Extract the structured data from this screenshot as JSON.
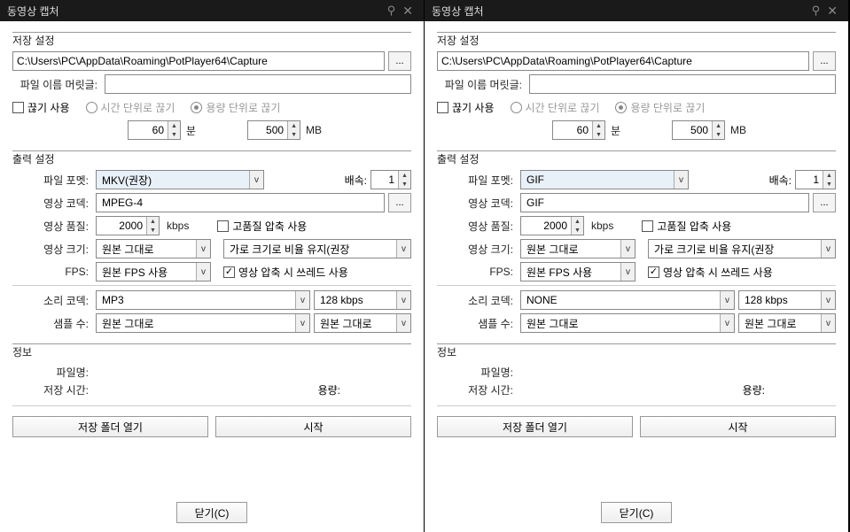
{
  "panels": [
    {
      "title": "동영상 캡처",
      "save": {
        "group": "저장 설정",
        "path": "C:\\Users\\PC\\AppData\\Roaming\\PotPlayer64\\Capture",
        "prefix_label": "파일 이름 머릿글:",
        "prefix_value": "",
        "cut_use": "끊기 사용",
        "cut_time_label": "시간 단위로 끊기",
        "cut_size_label": "용량 단위로 끊기",
        "cut_time_val": "60",
        "cut_time_unit": "분",
        "cut_size_val": "500",
        "cut_size_unit": "MB"
      },
      "output": {
        "group": "출력 설정",
        "format_label": "파일 포멧:",
        "format_value": "MKV(권장)",
        "speed_label": "배속:",
        "speed_value": "1",
        "vcodec_label": "영상 코덱:",
        "vcodec_value": "MPEG-4",
        "vqual_label": "영상 품질:",
        "vqual_value": "2000",
        "vqual_unit": "kbps",
        "hq_label": "고품질 압축 사용",
        "hq_checked": false,
        "vsize_label": "영상 크기:",
        "vsize_value": "원본 그대로",
        "aspect_value": "가로 크기로 비율 유지(권장",
        "fps_label": "FPS:",
        "fps_value": "원본 FPS 사용",
        "thread_label": "영상 압축 시 쓰레드 사용",
        "thread_checked": true,
        "acodec_label": "소리 코덱:",
        "acodec_value": "MP3",
        "abitrate_value": "128 kbps",
        "asample_label": "샘플 수:",
        "asample_value": "원본 그대로",
        "asample2_value": "원본 그대로"
      },
      "info": {
        "group": "정보",
        "filename_label": "파일명:",
        "time_label": "저장 시간:",
        "size_label": "용량:"
      },
      "buttons": {
        "open_folder": "저장 폴더 열기",
        "start": "시작",
        "close": "닫기(C)"
      }
    },
    {
      "title": "동영상 캡처",
      "save": {
        "group": "저장 설정",
        "path": "C:\\Users\\PC\\AppData\\Roaming\\PotPlayer64\\Capture",
        "prefix_label": "파일 이름 머릿글:",
        "prefix_value": "",
        "cut_use": "끊기 사용",
        "cut_time_label": "시간 단위로 끊기",
        "cut_size_label": "용량 단위로 끊기",
        "cut_time_val": "60",
        "cut_time_unit": "분",
        "cut_size_val": "500",
        "cut_size_unit": "MB"
      },
      "output": {
        "group": "출력 설정",
        "format_label": "파일 포멧:",
        "format_value": "GIF",
        "speed_label": "배속:",
        "speed_value": "1",
        "vcodec_label": "영상 코덱:",
        "vcodec_value": "GIF",
        "vqual_label": "영상 품질:",
        "vqual_value": "2000",
        "vqual_unit": "kbps",
        "hq_label": "고품질 압축 사용",
        "hq_checked": false,
        "vsize_label": "영상 크기:",
        "vsize_value": "원본 그대로",
        "aspect_value": "가로 크기로 비율 유지(권장",
        "fps_label": "FPS:",
        "fps_value": "원본 FPS 사용",
        "thread_label": "영상 압축 시 쓰레드 사용",
        "thread_checked": true,
        "acodec_label": "소리 코덱:",
        "acodec_value": "NONE",
        "abitrate_value": "128 kbps",
        "asample_label": "샘플 수:",
        "asample_value": "원본 그대로",
        "asample2_value": "원본 그대로"
      },
      "info": {
        "group": "정보",
        "filename_label": "파일명:",
        "time_label": "저장 시간:",
        "size_label": "용량:"
      },
      "buttons": {
        "open_folder": "저장 폴더 열기",
        "start": "시작",
        "close": "닫기(C)"
      }
    }
  ]
}
